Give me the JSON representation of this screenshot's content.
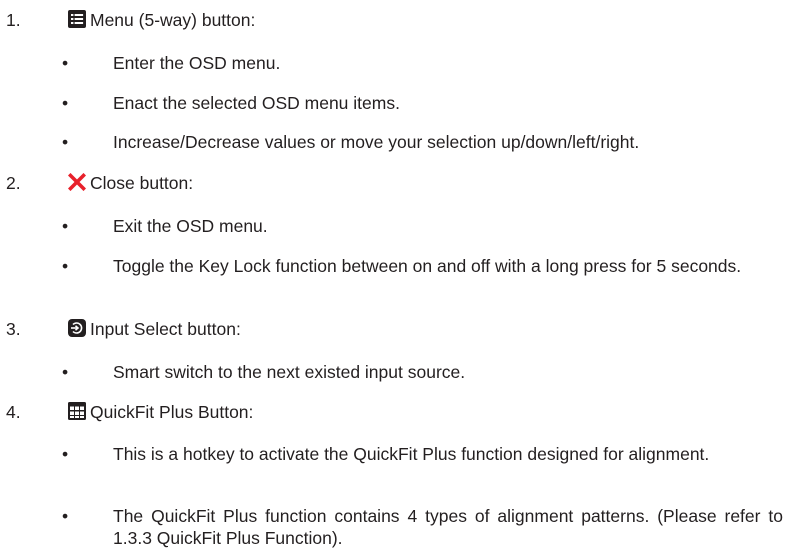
{
  "items": [
    {
      "number": "1.",
      "icon": "menu-icon",
      "title": "Menu (5-way) button:",
      "bullets": [
        "Enter the OSD menu.",
        "Enact the selected OSD menu items.",
        "Increase/Decrease values or move your selection up/down/left/right."
      ]
    },
    {
      "number": "2.",
      "icon": "close-x-icon",
      "title": "Close button:",
      "bullets": [
        "Exit the OSD menu.",
        "Toggle the Key Lock function between on and off with a long press for 5 seconds."
      ]
    },
    {
      "number": "3.",
      "icon": "input-select-icon",
      "title": "Input Select button:",
      "bullets": [
        "Smart switch to the next existed input source."
      ]
    },
    {
      "number": "4.",
      "icon": "quickfit-grid-icon",
      "title": "QuickFit Plus Button:",
      "bullets": [
        "This is a hotkey to activate the QuickFit Plus function designed for alignment.",
        "The QuickFit Plus function contains 4 types of alignment patterns. (Please refer to 1.3.3 QuickFit Plus Function)."
      ]
    }
  ],
  "bullet_symbol": "•",
  "colors": {
    "text": "#231f20",
    "icon_dark": "#231f20",
    "close_red": "#e8212b"
  }
}
